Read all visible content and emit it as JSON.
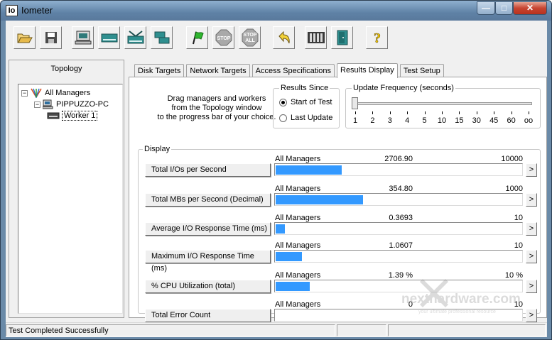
{
  "window": {
    "app_icon_text": "Io",
    "title": "Iometer",
    "min_glyph": "—",
    "max_glyph": "□",
    "close_glyph": "✕"
  },
  "toolbar": {
    "buttons": [
      {
        "icon": "open-folder-icon"
      },
      {
        "icon": "save-disk-icon"
      },
      {
        "icon": "display-manager-icon"
      },
      {
        "icon": "disk-worker-icon"
      },
      {
        "icon": "network-worker-icon"
      },
      {
        "icon": "duplicate-worker-icon"
      },
      {
        "icon": "start-flag-icon"
      },
      {
        "icon": "stop-icon",
        "label": "STOP"
      },
      {
        "icon": "stop-all-icon",
        "label": "STOP\nALL"
      },
      {
        "icon": "reset-workers-icon"
      },
      {
        "icon": "exit-icon"
      },
      {
        "icon": "help-icon",
        "label": "?"
      }
    ]
  },
  "topology": {
    "title": "Topology",
    "root": {
      "label": "All Managers",
      "expander": "−"
    },
    "manager": {
      "label": "PIPPUZZO-PC",
      "expander": "−"
    },
    "worker": {
      "label": "Worker 1"
    }
  },
  "tabs": [
    {
      "label": "Disk Targets",
      "active": false
    },
    {
      "label": "Network Targets",
      "active": false
    },
    {
      "label": "Access Specifications",
      "active": false
    },
    {
      "label": "Results Display",
      "active": true
    },
    {
      "label": "Test Setup",
      "active": false
    }
  ],
  "instructions": {
    "line1": "Drag managers and workers",
    "line2": "from the Topology window",
    "line3": "to the progress bar of your choice."
  },
  "results_since": {
    "title": "Results Since",
    "options": [
      {
        "label": "Start of Test",
        "checked": true
      },
      {
        "label": "Last Update",
        "checked": false
      }
    ]
  },
  "update_frequency": {
    "title": "Update Frequency (seconds)",
    "labels": [
      "1",
      "2",
      "3",
      "4",
      "5",
      "10",
      "15",
      "30",
      "45",
      "60",
      "oo"
    ],
    "selected_label": "1"
  },
  "display": {
    "title": "Display",
    "more_glyph": ">",
    "metrics": [
      {
        "label": "Total I/Os per Second",
        "who": "All Managers",
        "value": "2706.90",
        "max": "10000",
        "fill_fraction": 0.27
      },
      {
        "label": "Total MBs per Second (Decimal)",
        "who": "All Managers",
        "value": "354.80",
        "max": "1000",
        "fill_fraction": 0.355
      },
      {
        "label": "Average I/O Response Time (ms)",
        "who": "All Managers",
        "value": "0.3693",
        "max": "10",
        "fill_fraction": 0.037
      },
      {
        "label": "Maximum I/O Response Time (ms)",
        "who": "All Managers",
        "value": "1.0607",
        "max": "10",
        "fill_fraction": 0.106
      },
      {
        "label": "% CPU Utilization (total)",
        "who": "All Managers",
        "value": "1.39 %",
        "max": "10 %",
        "fill_fraction": 0.139
      },
      {
        "label": "Total Error Count",
        "who": "All Managers",
        "value": "0",
        "max": "10",
        "fill_fraction": 0.0
      }
    ]
  },
  "status": {
    "text": "Test Completed Successfully"
  },
  "watermark": {
    "brand": "nexthardware.com",
    "tagline": "your ultimate professional resource"
  },
  "colors": {
    "bar_fill": "#3399ff",
    "titlebar": "#6a8aa8"
  }
}
